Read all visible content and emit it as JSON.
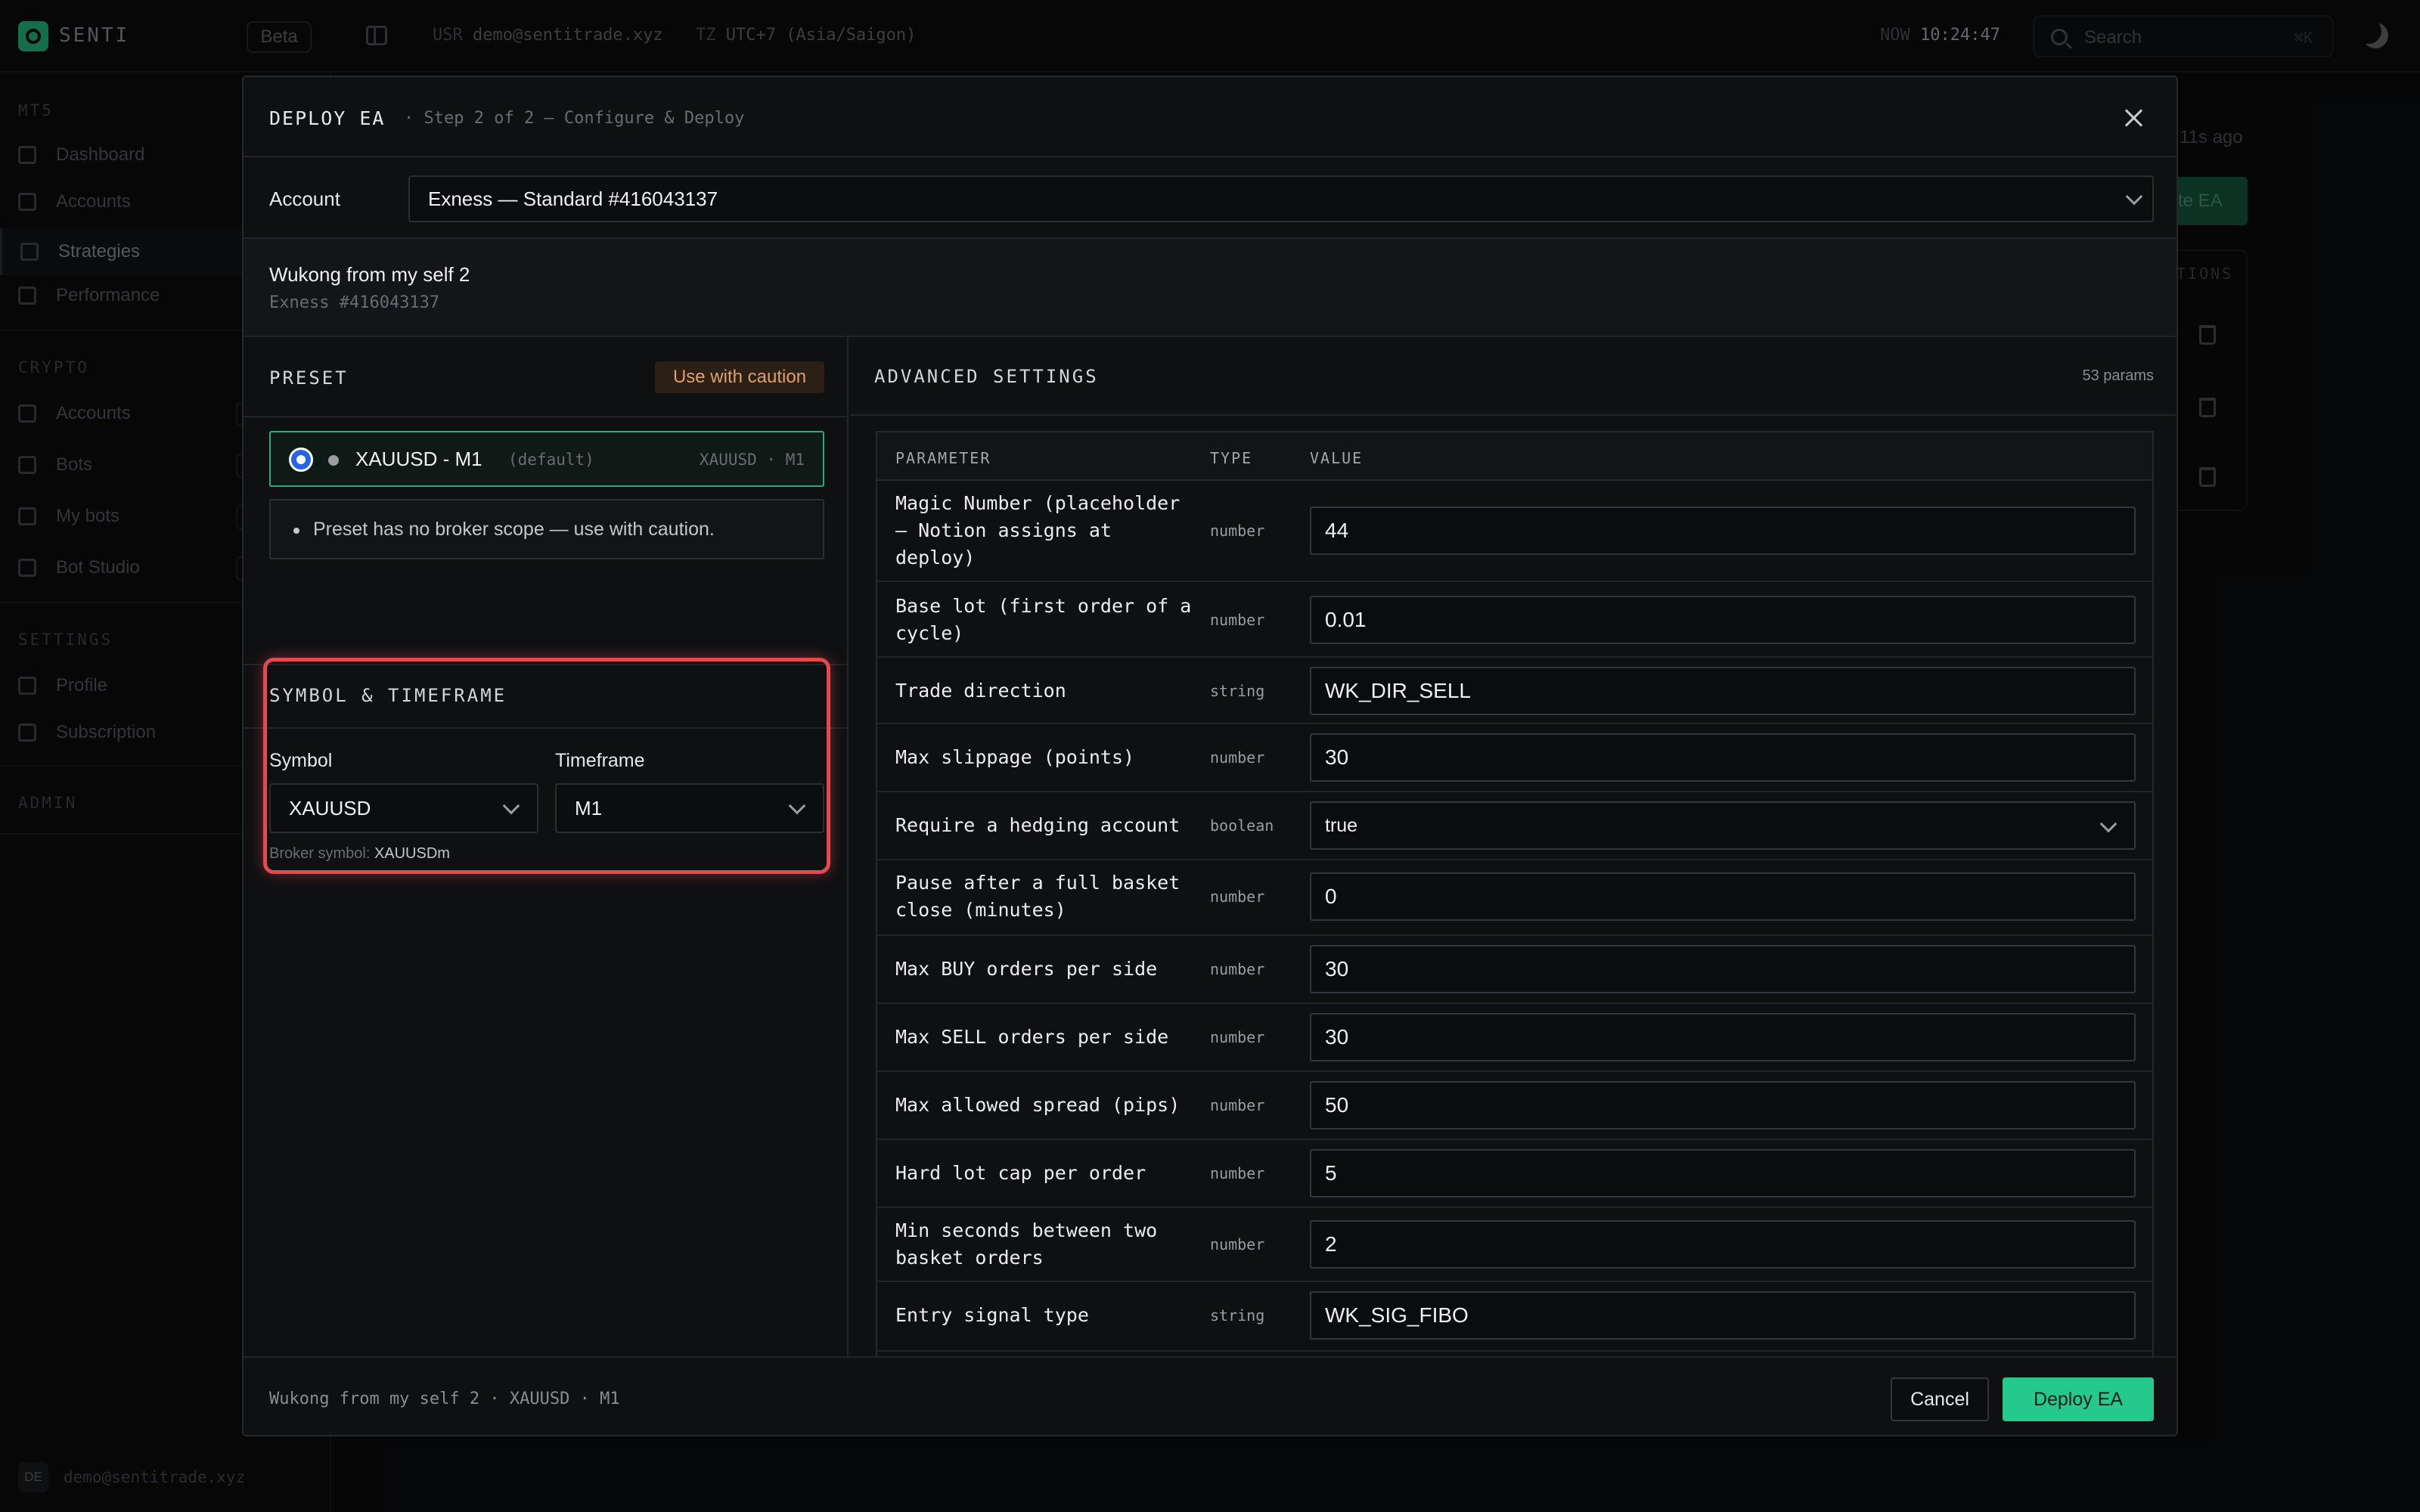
{
  "app": {
    "brand": "SENTI",
    "beta_label": "Beta",
    "user_label": "USR",
    "user_email": "demo@sentitrade.xyz",
    "tz_label": "TZ",
    "tz_value": "UTC+7 (Asia/Saigon)",
    "now_label": "NOW",
    "now_value": "10:24:47",
    "search_placeholder": "Search",
    "search_shortcut": "⌘K",
    "accent_color": "#26c98d"
  },
  "sidebar": {
    "sections": [
      {
        "title": "MT5",
        "items": [
          "Dashboard",
          "Accounts",
          "Strategies",
          "Performance"
        ]
      },
      {
        "title": "CRYPTO",
        "items": [
          "Accounts",
          "Bots",
          "My bots",
          "Bot Studio"
        ]
      },
      {
        "title": "SETTINGS",
        "items": [
          "Profile",
          "Subscription"
        ]
      },
      {
        "title": "ADMIN",
        "items": []
      }
    ],
    "active_item": "Strategies",
    "footer_initials": "DE",
    "footer_email": "demo@sentitrade.xyz"
  },
  "background": {
    "updated_text": "11s ago",
    "create_button_fragment": "te EA",
    "column_fragment": "TIONS"
  },
  "modal": {
    "title": "DEPLOY EA",
    "subtitle": "· Step 2 of 2 — Configure & Deploy",
    "account_label": "Account",
    "account_value": "Exness — Standard #416043137",
    "strategy_name": "Wukong from my self 2",
    "strategy_account": "Exness #416043137",
    "preset": {
      "title": "PRESET",
      "caution_badge": "Use with caution",
      "name": "XAUUSD - M1",
      "default_tag": "(default)",
      "scope_tag": "XAUUSD · M1",
      "warning": "Preset has no broker scope — use with caution."
    },
    "symbol_timeframe": {
      "title": "SYMBOL & TIMEFRAME",
      "symbol_label": "Symbol",
      "symbol_value": "XAUUSD",
      "timeframe_label": "Timeframe",
      "timeframe_value": "M1",
      "broker_label": "Broker symbol:",
      "broker_value": "XAUUSDm"
    },
    "advanced": {
      "title": "ADVANCED SETTINGS",
      "count": "53 params",
      "columns": [
        "PARAMETER",
        "TYPE",
        "VALUE"
      ],
      "rows": [
        {
          "name": "Magic Number (placeholder — Notion assigns at deploy)",
          "type": "number",
          "value": "44"
        },
        {
          "name": "Base lot (first order of a cycle)",
          "type": "number",
          "value": "0.01"
        },
        {
          "name": "Trade direction",
          "type": "string",
          "value": "WK_DIR_SELL"
        },
        {
          "name": "Max slippage (points)",
          "type": "number",
          "value": "30"
        },
        {
          "name": "Require a hedging account",
          "type": "boolean",
          "value": "true"
        },
        {
          "name": "Pause after a full basket close (minutes)",
          "type": "number",
          "value": "0"
        },
        {
          "name": "Max BUY orders per side",
          "type": "number",
          "value": "30"
        },
        {
          "name": "Max SELL orders per side",
          "type": "number",
          "value": "30"
        },
        {
          "name": "Max allowed spread (pips)",
          "type": "number",
          "value": "50"
        },
        {
          "name": "Hard lot cap per order",
          "type": "number",
          "value": "5"
        },
        {
          "name": "Min seconds between two basket orders",
          "type": "number",
          "value": "2"
        },
        {
          "name": "Entry signal type",
          "type": "string",
          "value": "WK_SIG_FIBO"
        }
      ]
    },
    "footer_summary": "Wukong from my self 2 · XAUUSD · M1",
    "cancel_label": "Cancel",
    "deploy_label": "Deploy EA"
  }
}
